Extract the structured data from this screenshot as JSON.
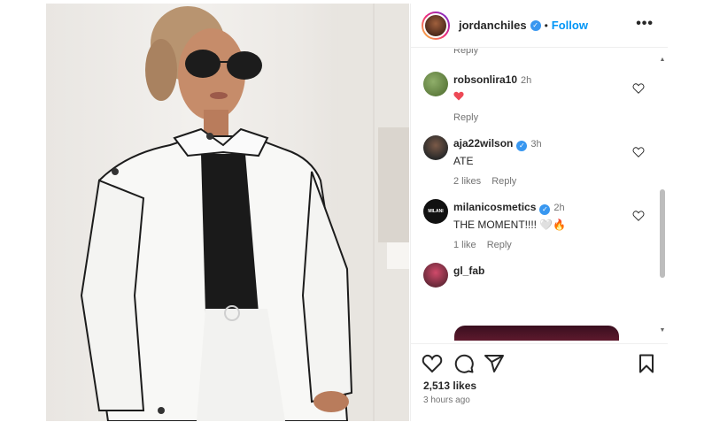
{
  "post": {
    "username": "jordanchiles",
    "follow_label": "Follow",
    "separator": "•",
    "more_label": "•••",
    "likes": "2,513 likes",
    "time_ago": "3 hours ago"
  },
  "comments": {
    "partial_reply_label": "Reply",
    "items": [
      {
        "username": "robsonlira10",
        "time": "2h",
        "text": "",
        "emoji": "red-heart",
        "verified": false,
        "meta": [
          "Reply"
        ]
      },
      {
        "username": "aja22wilson",
        "time": "3h",
        "text": "ATE",
        "verified": true,
        "meta": [
          "2 likes",
          "Reply"
        ]
      },
      {
        "username": "milanicosmetics",
        "time": "2h",
        "text": "THE MOMENT!!!! 🤍🔥",
        "verified": true,
        "meta": [
          "1 like",
          "Reply"
        ]
      },
      {
        "username": "gl_fab",
        "time": "",
        "text": "",
        "verified": false,
        "meta": []
      }
    ]
  },
  "icons": {
    "verified": "verified-badge-icon",
    "like": "heart-icon",
    "comment": "comment-icon",
    "share": "share-icon",
    "save": "bookmark-icon",
    "next": "chevron-right-icon"
  },
  "colors": {
    "accent": "#0095f6",
    "verified": "#3897f0",
    "muted": "#737373",
    "heart_red": "#ed4956"
  }
}
